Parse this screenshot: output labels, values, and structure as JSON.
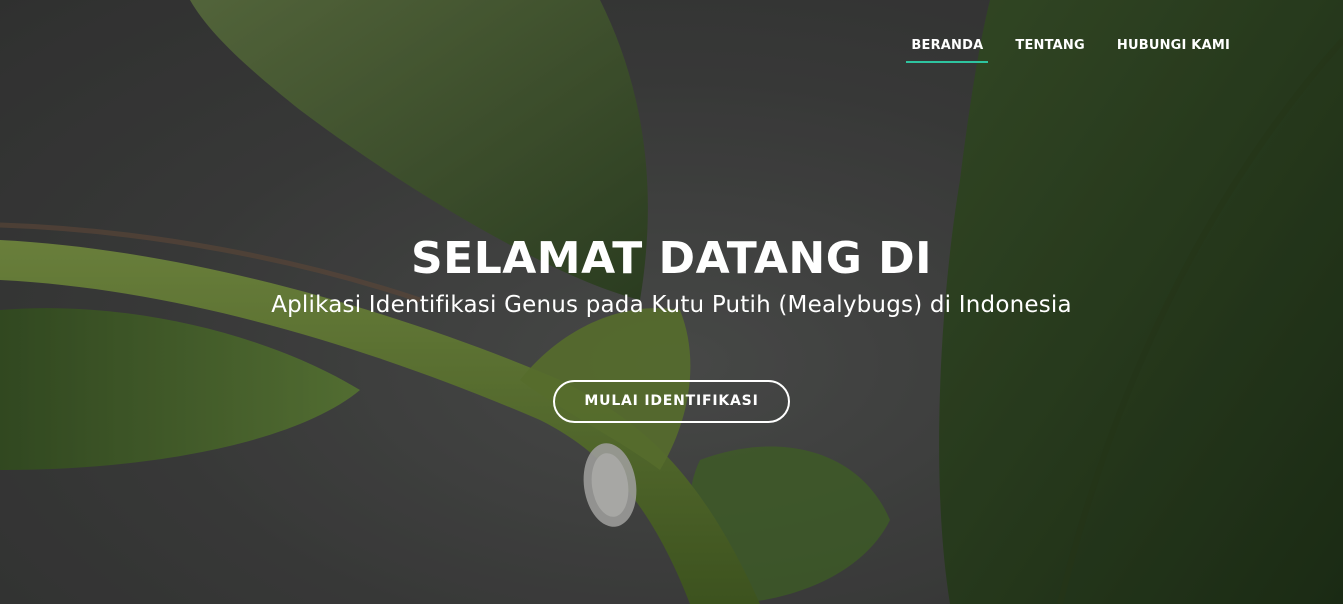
{
  "nav": {
    "items": [
      {
        "label": "BERANDA",
        "active": true
      },
      {
        "label": "TENTANG",
        "active": false
      },
      {
        "label": "HUBUNGI KAMI",
        "active": false
      }
    ]
  },
  "hero": {
    "title": "SELAMAT DATANG DI",
    "subtitle": "Aplikasi Identifikasi Genus pada Kutu Putih (Mealybugs) di Indonesia",
    "cta_label": "MULAI IDENTIFIKASI"
  },
  "colors": {
    "accent": "#2ec4a0",
    "text": "#ffffff"
  }
}
